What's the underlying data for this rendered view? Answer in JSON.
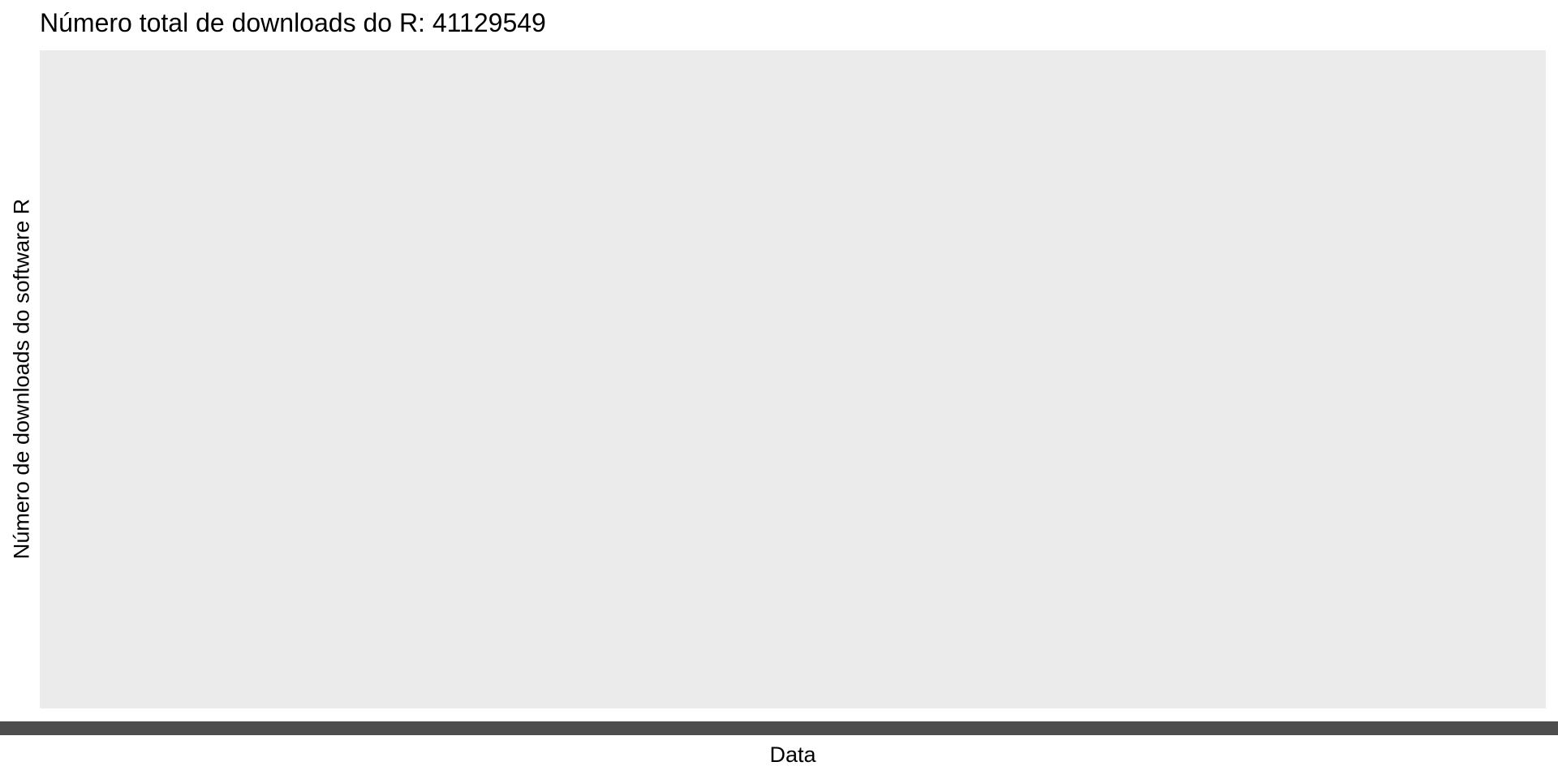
{
  "chart_data": {
    "type": "line",
    "title": "Número total de downloads do R: 41129549",
    "xlabel": "Data",
    "ylabel": "Número de downloads do software R",
    "series": [],
    "grid": false,
    "panel_background": "#ebebeb",
    "band_color": "#4d4d4d"
  }
}
